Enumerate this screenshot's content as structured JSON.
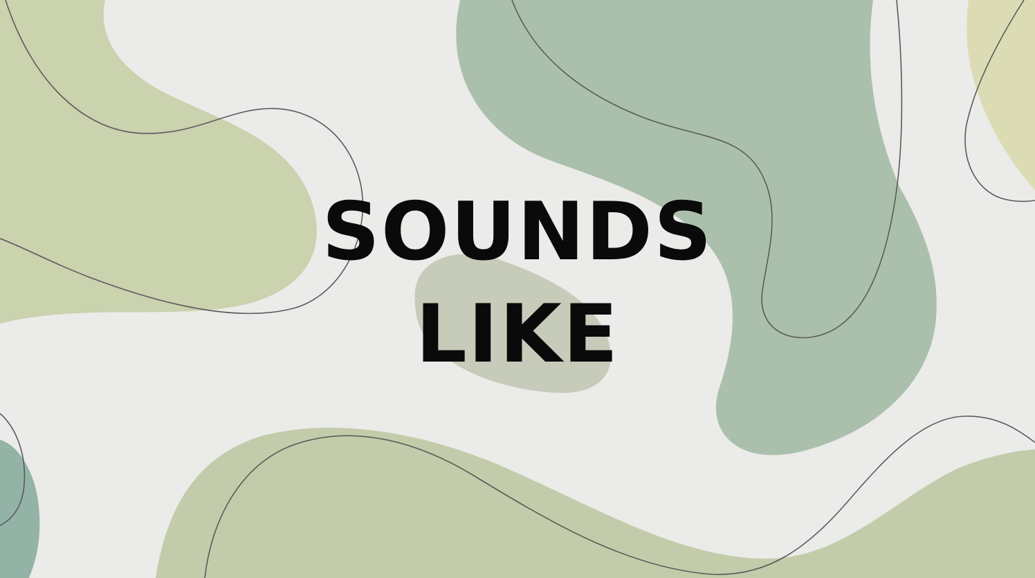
{
  "title": {
    "line1": "SOUNDS",
    "line2": "LIKE"
  },
  "colors": {
    "background": "#ebebe9",
    "olive_blob": "#cad2ae",
    "sage_blob": "#abc0ac",
    "greige_blob": "#c7cbba",
    "teal_blob": "#93b3a6",
    "sand_blob": "#dcdcb4",
    "bottom_blob": "#c2ccaa",
    "line": "#5a5a5a",
    "text": "#0a0a0a"
  }
}
